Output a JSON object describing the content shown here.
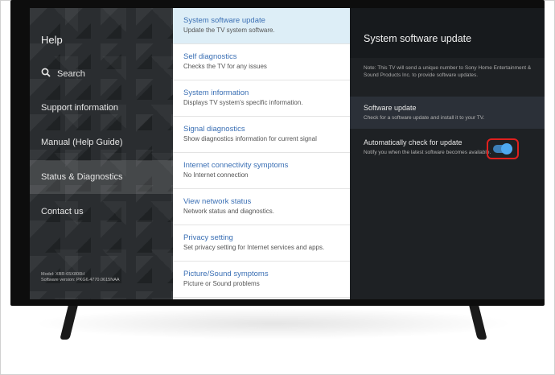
{
  "left_menu": {
    "title": "Help",
    "search_label": "Search",
    "items": [
      {
        "label": "Support information",
        "active": false
      },
      {
        "label": "Manual (Help Guide)",
        "active": false
      },
      {
        "label": "Status & Diagnostics",
        "active": true
      },
      {
        "label": "Contact us",
        "active": false
      }
    ],
    "model_line": "Model: XBR-65X800H",
    "software_line": "Software version: PKG6.4770.0615NAA"
  },
  "middle_list": {
    "items": [
      {
        "title": "System software update",
        "subtitle": "Update the TV system software.",
        "active": true
      },
      {
        "title": "Self diagnostics",
        "subtitle": "Checks the TV for any issues",
        "active": false
      },
      {
        "title": "System information",
        "subtitle": "Displays TV system's specific information.",
        "active": false
      },
      {
        "title": "Signal diagnostics",
        "subtitle": "Show diagnostics information for current signal",
        "active": false
      },
      {
        "title": "Internet connectivity symptoms",
        "subtitle": "No Internet connection",
        "active": false
      },
      {
        "title": "View network status",
        "subtitle": "Network status and diagnostics.",
        "active": false
      },
      {
        "title": "Privacy setting",
        "subtitle": "Set privacy setting for Internet services and apps.",
        "active": false
      },
      {
        "title": "Picture/Sound symptoms",
        "subtitle": "Picture or Sound problems",
        "active": false
      }
    ]
  },
  "detail": {
    "title": "System software update",
    "note": "Note: This TV will send a unique number to Sony Home Entertainment & Sound Products Inc. to provide software updates.",
    "software_update_title": "Software update",
    "software_update_sub": "Check for a software update and install it to your TV.",
    "auto_check_title": "Automatically check for update",
    "auto_check_sub": "Notify you when the latest software becomes available.",
    "auto_check_enabled": true
  },
  "colors": {
    "accent": "#3a6fb4",
    "toggle_on": "#4ea8f0",
    "highlight_ring": "#e0201e"
  }
}
